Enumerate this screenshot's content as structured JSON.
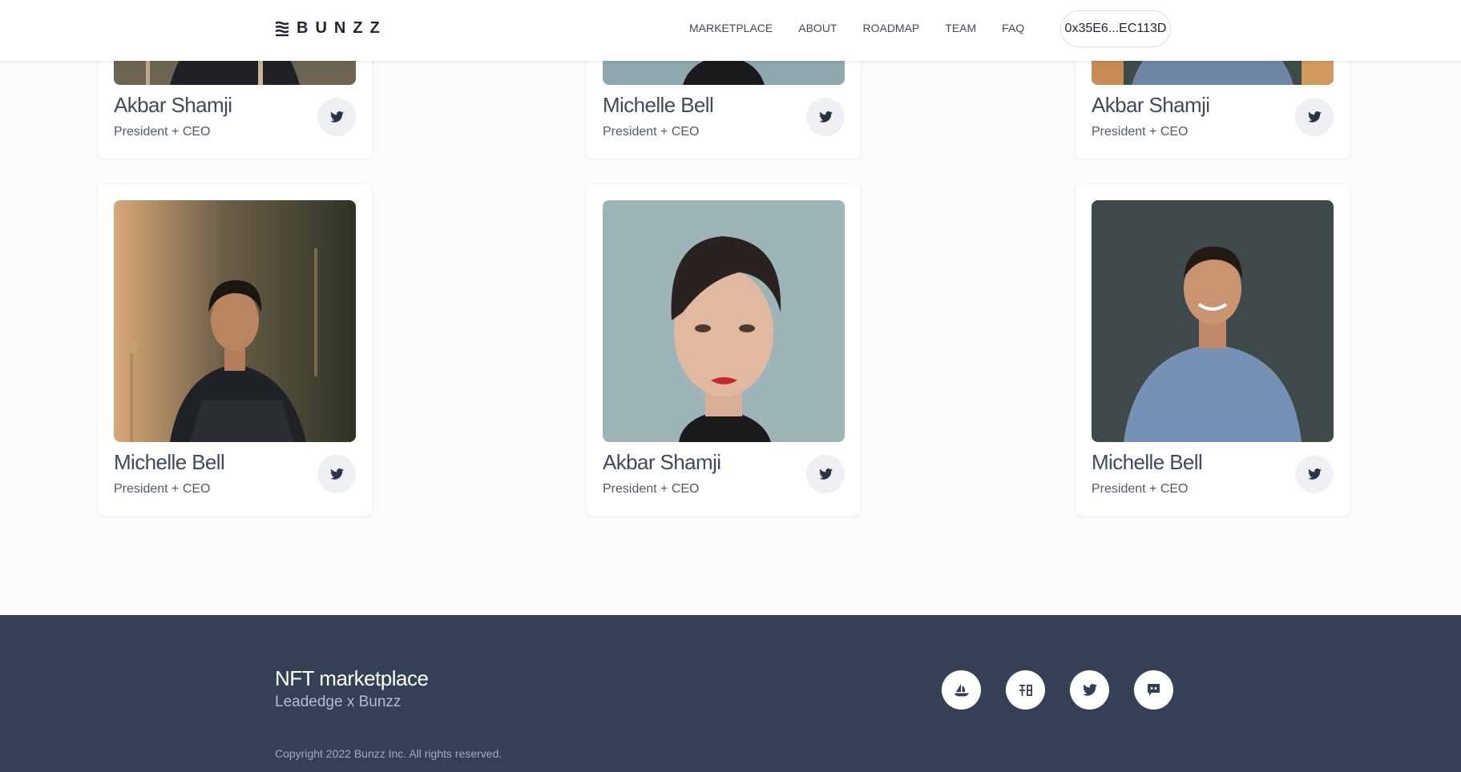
{
  "header": {
    "logo_text": "BUNZZ",
    "nav": [
      "MARKETPLACE",
      "ABOUT",
      "ROADMAP",
      "TEAM",
      "FAQ"
    ],
    "wallet_address": "0x35E6...EC113D"
  },
  "team": {
    "twitter_icon": "twitter-icon",
    "members": [
      {
        "name": "Akbar Shamji",
        "role": "President + CEO"
      },
      {
        "name": "Michelle Bell",
        "role": "President + CEO"
      },
      {
        "name": "Akbar Shamji",
        "role": "President + CEO"
      },
      {
        "name": "Michelle Bell",
        "role": "President + CEO"
      },
      {
        "name": "Akbar Shamji",
        "role": "President + CEO"
      },
      {
        "name": "Michelle Bell",
        "role": "President + CEO"
      }
    ]
  },
  "footer": {
    "title": "NFT marketplace",
    "subtitle": "Leadedge x Bunzz",
    "copyright": "Copyright 2022 Bunzz Inc. All rights reserved.",
    "social_icons": [
      "opensea-icon",
      "etherscan-icon",
      "twitter-icon",
      "discord-icon"
    ]
  },
  "colors": {
    "footer_bg": "#334055",
    "text_dark": "#323e53",
    "page_bg": "#fbfbfb"
  }
}
